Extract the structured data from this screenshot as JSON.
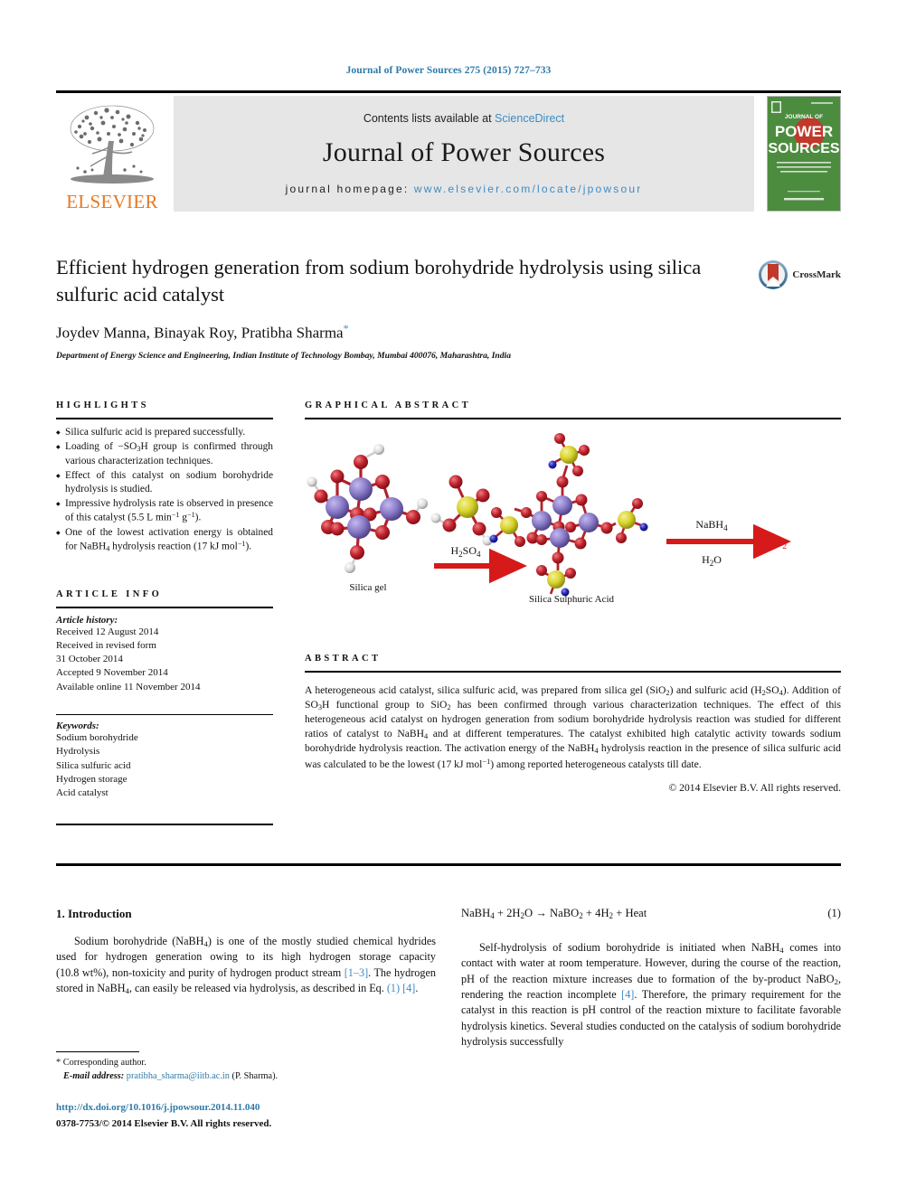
{
  "running_head": "Journal of Power Sources 275 (2015) 727–733",
  "masthead": {
    "publisher": "ELSEVIER",
    "contents_prefix": "Contents lists available at ",
    "contents_link": "ScienceDirect",
    "journal_name": "Journal of Power Sources",
    "homepage_prefix": "journal homepage: ",
    "homepage_url": "www.elsevier.com/locate/jpowsour",
    "cover_title_1": "JOURNAL OF",
    "cover_title_2": "POWER",
    "cover_title_3": "SOURCES",
    "cover_color": "#4c8c3f"
  },
  "article": {
    "title": "Efficient hydrogen generation from sodium borohydride hydrolysis using silica sulfuric acid catalyst",
    "authors": "Joydev Manna, Binayak Roy, Pratibha Sharma",
    "corresponding_marker": "*",
    "affiliation": "Department of Energy Science and Engineering, Indian Institute of Technology Bombay, Mumbai 400076, Maharashtra, India",
    "crossmark_label": "CrossMark"
  },
  "highlights": {
    "heading": "HIGHLIGHTS",
    "items": [
      "Silica sulfuric acid is prepared successfully.",
      "Loading of −SO3H group is confirmed through various characterization techniques.",
      "Effect of this catalyst on sodium borohydride hydrolysis is studied.",
      "Impressive hydrolysis rate is observed in presence of this catalyst (5.5 L min−1 g−1).",
      "One of the lowest activation energy is obtained for NaBH4 hydrolysis reaction (17 kJ mol−1)."
    ]
  },
  "graphical_abstract": {
    "heading": "GRAPHICAL ABSTRACT",
    "label_left": "Silica gel",
    "label_middle": "Silica Sulphuric Acid",
    "reagent_1": "H2SO4",
    "reagent_2_top": "NaBH4",
    "reagent_2_bottom": "H2O",
    "product": "H2",
    "arrow_color": "#d61a1a",
    "product_color": "#d61a1a",
    "atom_colors": {
      "silicon": "#8a7bc8",
      "oxygen": "#c0232c",
      "hydrogen": "#e8e8e8",
      "sulfur": "#d8d32a",
      "nitrogen": "#2222bb"
    }
  },
  "article_info": {
    "heading": "ARTICLE INFO",
    "history_label": "Article history:",
    "history": [
      "Received 12 August 2014",
      "Received in revised form",
      "31 October 2014",
      "Accepted 9 November 2014",
      "Available online 11 November 2014"
    ],
    "keywords_label": "Keywords:",
    "keywords": [
      "Sodium borohydride",
      "Hydrolysis",
      "Silica sulfuric acid",
      "Hydrogen storage",
      "Acid catalyst"
    ]
  },
  "abstract": {
    "heading": "ABSTRACT",
    "body": "A heterogeneous acid catalyst, silica sulfuric acid, was prepared from silica gel (SiO2) and sulfuric acid (H2SO4). Addition of SO3H functional group to SiO2 has been confirmed through various characterization techniques. The effect of this heterogeneous acid catalyst on hydrogen generation from sodium borohydride hydrolysis reaction was studied for different ratios of catalyst to NaBH4 and at different temperatures. The catalyst exhibited high catalytic activity towards sodium borohydride hydrolysis reaction. The activation energy of the NaBH4 hydrolysis reaction in the presence of silica sulfuric acid was calculated to be the lowest (17 kJ mol−1) among reported heterogeneous catalysts till date.",
    "copyright": "© 2014 Elsevier B.V. All rights reserved."
  },
  "body": {
    "intro_heading": "1. Introduction",
    "intro_paragraph": "Sodium borohydride (NaBH4) is one of the mostly studied chemical hydrides used for hydrogen generation owing to its high hydrogen storage capacity (10.8 wt%), non-toxicity and purity of hydrogen product stream [1–3]. The hydrogen stored in NaBH4, can easily be released via hydrolysis, as described in Eq. (1) [4].",
    "equation": "NaBH4 + 2H2O → NaBO2 + 4H2 + Heat",
    "equation_number": "(1)",
    "right_paragraph": "Self-hydrolysis of sodium borohydride is initiated when NaBH4 comes into contact with water at room temperature. However, during the course of the reaction, pH of the reaction mixture increases due to formation of the by-product NaBO2, rendering the reaction incomplete [4]. Therefore, the primary requirement for the catalyst in this reaction is pH control of the reaction mixture to facilitate favorable hydrolysis kinetics. Several studies conducted on the catalysis of sodium borohydride hydrolysis successfully"
  },
  "footnote": {
    "corresponding": "* Corresponding author.",
    "email_label": "E-mail address:",
    "email": "pratibha_sharma@iitb.ac.in",
    "email_suffix": "(P. Sharma).",
    "doi": "http://dx.doi.org/10.1016/j.jpowsour.2014.11.040",
    "issn": "0378-7753/© 2014 Elsevier B.V. All rights reserved."
  },
  "colors": {
    "link_blue": "#3e8bc4",
    "header_blue": "#2e7aa8",
    "elsevier_orange": "#e87722",
    "masthead_grey": "#e6e6e6"
  }
}
